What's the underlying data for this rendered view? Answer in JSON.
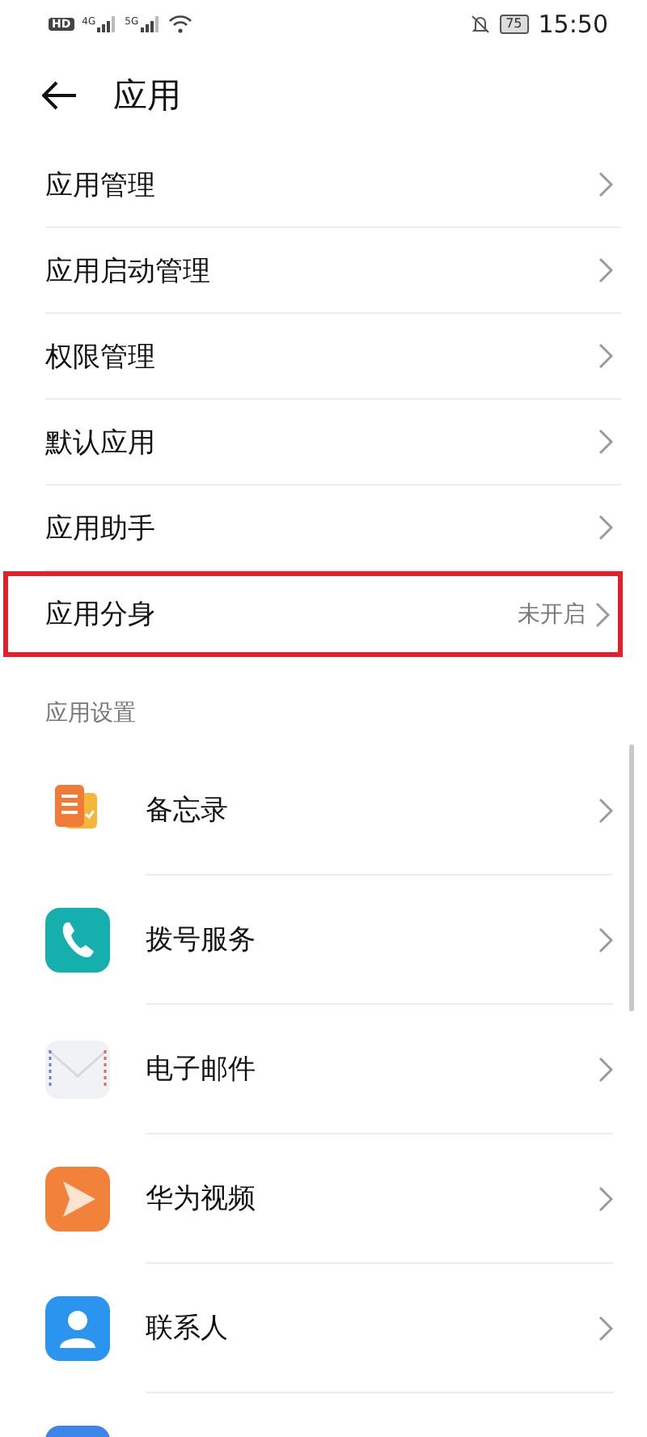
{
  "status_bar": {
    "hd_label": "HD",
    "networks": [
      {
        "label": "4G"
      },
      {
        "label": "5G"
      }
    ],
    "battery": "75",
    "time": "15:50"
  },
  "header": {
    "title": "应用"
  },
  "menu": [
    {
      "label": "应用管理",
      "highlighted": false
    },
    {
      "label": "应用启动管理",
      "highlighted": false
    },
    {
      "label": "权限管理",
      "highlighted": false
    },
    {
      "label": "默认应用",
      "highlighted": false
    },
    {
      "label": "应用助手",
      "highlighted": false
    },
    {
      "label": "应用分身",
      "value": "未开启",
      "highlighted": true
    }
  ],
  "section": {
    "title": "应用设置"
  },
  "apps": [
    {
      "label": "备忘录",
      "kind": "memo"
    },
    {
      "label": "拨号服务",
      "kind": "phone"
    },
    {
      "label": "电子邮件",
      "kind": "mail"
    },
    {
      "label": "华为视频",
      "kind": "video"
    },
    {
      "label": "联系人",
      "kind": "contacts"
    },
    {
      "kind": "blue"
    }
  ]
}
